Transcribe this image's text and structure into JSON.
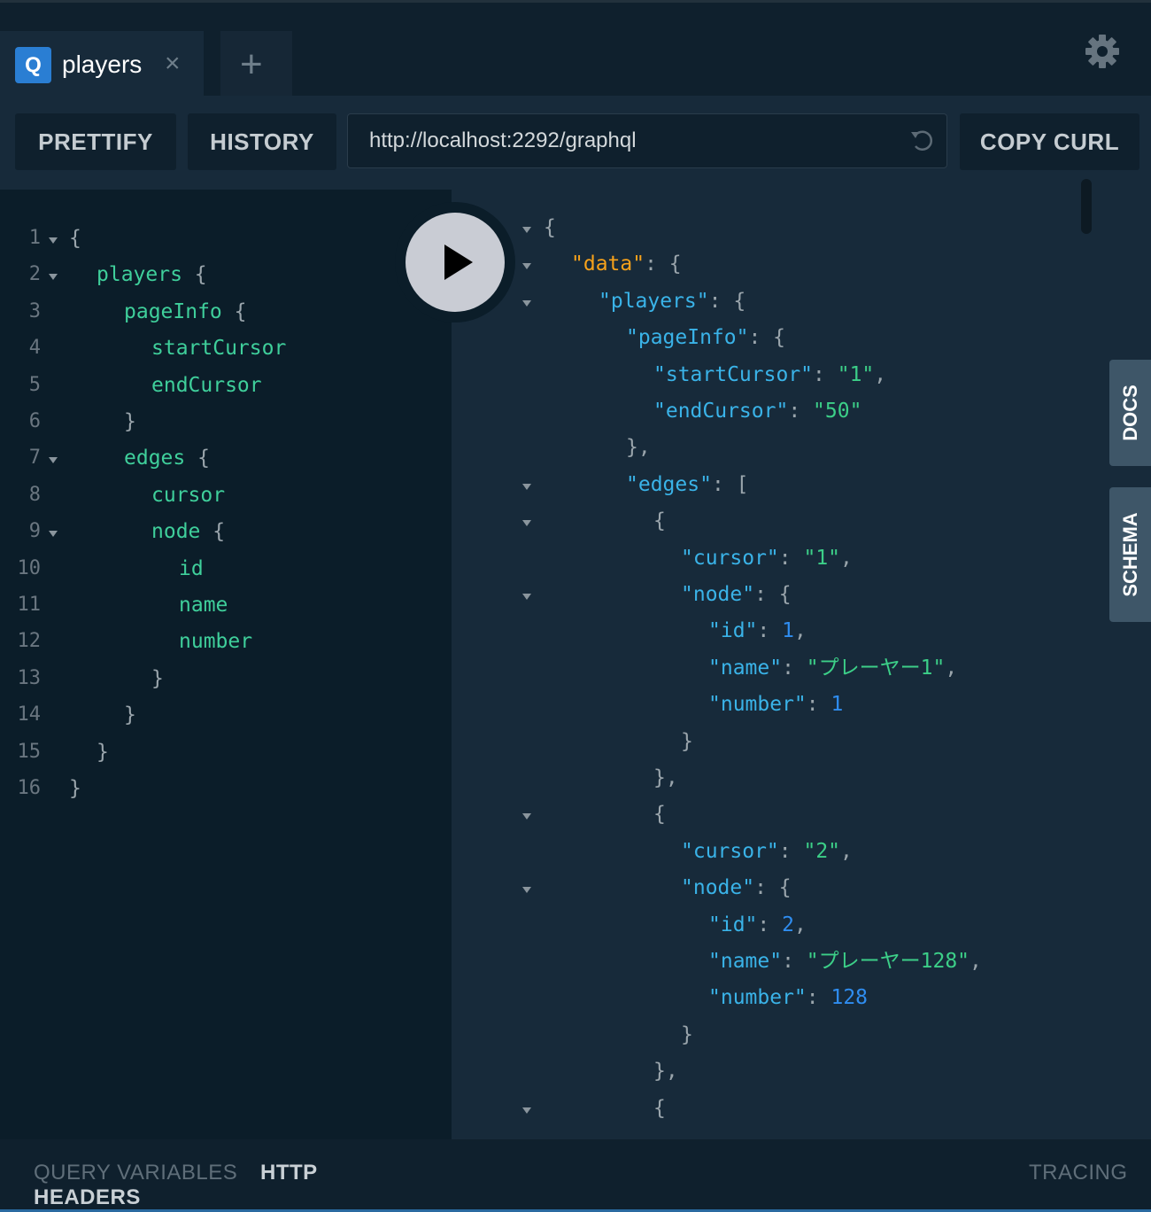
{
  "tabs": [
    {
      "badge": "Q",
      "title": "players",
      "close": "×"
    }
  ],
  "new_tab_label": "+",
  "toolbar": {
    "prettify": "PRETTIFY",
    "history": "HISTORY",
    "url": "http://localhost:2292/graphql",
    "copy_curl": "COPY CURL"
  },
  "query_lines": [
    {
      "n": "1",
      "parts": [
        [
          "pn",
          "{"
        ]
      ]
    },
    {
      "n": "2",
      "parts": [
        [
          "kw",
          "players"
        ],
        [
          "pn",
          " {"
        ]
      ]
    },
    {
      "n": "3",
      "parts": [
        [
          "kw",
          "pageInfo"
        ],
        [
          "pn",
          " {"
        ]
      ]
    },
    {
      "n": "4",
      "parts": [
        [
          "kw",
          "startCursor"
        ]
      ]
    },
    {
      "n": "5",
      "parts": [
        [
          "kw",
          "endCursor"
        ]
      ]
    },
    {
      "n": "6",
      "parts": [
        [
          "pn",
          "}"
        ]
      ]
    },
    {
      "n": "7",
      "parts": [
        [
          "kw",
          "edges"
        ],
        [
          "pn",
          " {"
        ]
      ]
    },
    {
      "n": "8",
      "parts": [
        [
          "kw",
          "cursor"
        ]
      ]
    },
    {
      "n": "9",
      "parts": [
        [
          "kw",
          "node"
        ],
        [
          "pn",
          " {"
        ]
      ]
    },
    {
      "n": "10",
      "parts": [
        [
          "kw",
          "id"
        ]
      ]
    },
    {
      "n": "11",
      "parts": [
        [
          "kw",
          "name"
        ]
      ]
    },
    {
      "n": "12",
      "parts": [
        [
          "kw",
          "number"
        ]
      ]
    },
    {
      "n": "13",
      "parts": [
        [
          "pn",
          "}"
        ]
      ]
    },
    {
      "n": "14",
      "parts": [
        [
          "pn",
          "}"
        ]
      ]
    },
    {
      "n": "15",
      "parts": [
        [
          "pn",
          "}"
        ]
      ]
    },
    {
      "n": "16",
      "parts": [
        [
          "pn",
          "}"
        ]
      ]
    }
  ],
  "result_lines": [
    {
      "parts": [
        [
          "pn",
          "{"
        ]
      ]
    },
    {
      "parts": [
        [
          "dkey",
          "\"data\""
        ],
        [
          "pn",
          ": {"
        ]
      ]
    },
    {
      "parts": [
        [
          "key",
          "\"players\""
        ],
        [
          "pn",
          ": {"
        ]
      ]
    },
    {
      "parts": [
        [
          "key",
          "\"pageInfo\""
        ],
        [
          "pn",
          ": {"
        ]
      ]
    },
    {
      "parts": [
        [
          "key",
          "\"startCursor\""
        ],
        [
          "pn",
          ": "
        ],
        [
          "str",
          "\"1\""
        ],
        [
          "pn",
          ","
        ]
      ]
    },
    {
      "parts": [
        [
          "key",
          "\"endCursor\""
        ],
        [
          "pn",
          ": "
        ],
        [
          "str",
          "\"50\""
        ]
      ]
    },
    {
      "parts": [
        [
          "pn",
          "},"
        ]
      ]
    },
    {
      "parts": [
        [
          "key",
          "\"edges\""
        ],
        [
          "pn",
          ": ["
        ]
      ]
    },
    {
      "parts": [
        [
          "pn",
          "{"
        ]
      ]
    },
    {
      "parts": [
        [
          "key",
          "\"cursor\""
        ],
        [
          "pn",
          ": "
        ],
        [
          "str",
          "\"1\""
        ],
        [
          "pn",
          ","
        ]
      ]
    },
    {
      "parts": [
        [
          "key",
          "\"node\""
        ],
        [
          "pn",
          ": {"
        ]
      ]
    },
    {
      "parts": [
        [
          "key",
          "\"id\""
        ],
        [
          "pn",
          ": "
        ],
        [
          "num",
          "1"
        ],
        [
          "pn",
          ","
        ]
      ]
    },
    {
      "parts": [
        [
          "key",
          "\"name\""
        ],
        [
          "pn",
          ": "
        ],
        [
          "str",
          "\"プレーヤー1\""
        ],
        [
          "pn",
          ","
        ]
      ]
    },
    {
      "parts": [
        [
          "key",
          "\"number\""
        ],
        [
          "pn",
          ": "
        ],
        [
          "num",
          "1"
        ]
      ]
    },
    {
      "parts": [
        [
          "pn",
          "}"
        ]
      ]
    },
    {
      "parts": [
        [
          "pn",
          "},"
        ]
      ]
    },
    {
      "parts": [
        [
          "pn",
          "{"
        ]
      ]
    },
    {
      "parts": [
        [
          "key",
          "\"cursor\""
        ],
        [
          "pn",
          ": "
        ],
        [
          "str",
          "\"2\""
        ],
        [
          "pn",
          ","
        ]
      ]
    },
    {
      "parts": [
        [
          "key",
          "\"node\""
        ],
        [
          "pn",
          ": {"
        ]
      ]
    },
    {
      "parts": [
        [
          "key",
          "\"id\""
        ],
        [
          "pn",
          ": "
        ],
        [
          "num",
          "2"
        ],
        [
          "pn",
          ","
        ]
      ]
    },
    {
      "parts": [
        [
          "key",
          "\"name\""
        ],
        [
          "pn",
          ": "
        ],
        [
          "str",
          "\"プレーヤー128\""
        ],
        [
          "pn",
          ","
        ]
      ]
    },
    {
      "parts": [
        [
          "key",
          "\"number\""
        ],
        [
          "pn",
          ": "
        ],
        [
          "num",
          "128"
        ]
      ]
    },
    {
      "parts": [
        [
          "pn",
          "}"
        ]
      ]
    },
    {
      "parts": [
        [
          "pn",
          "},"
        ]
      ]
    },
    {
      "parts": [
        [
          "pn",
          "{"
        ]
      ]
    }
  ],
  "side_tabs": {
    "docs": "DOCS",
    "schema": "SCHEMA"
  },
  "footer": {
    "query_variables": "QUERY VARIABLES",
    "http_headers": "HTTP HEADERS",
    "tracing": "TRACING"
  },
  "icons": {
    "settings": "gear-icon",
    "run": "play-icon",
    "reload": "reload-icon"
  }
}
